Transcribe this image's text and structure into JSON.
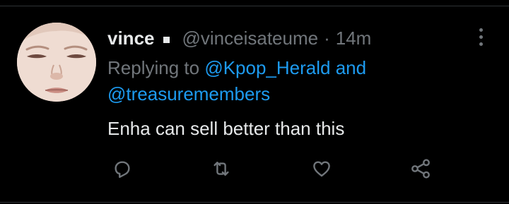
{
  "tweet": {
    "display_name": "vince",
    "handle": "@vinceisateume",
    "separator": "·",
    "timestamp": "14m",
    "reply_prefix": "Replying to ",
    "reply_mention_1": "@Kpop_Herald",
    "reply_conjunction": " and",
    "reply_mention_2": "@treasuremembers",
    "text": "Enha can sell better than this"
  },
  "icons": {
    "more": "more-vertical-icon",
    "reply": "reply-icon",
    "retweet": "retweet-icon",
    "like": "heart-icon",
    "share": "share-icon"
  },
  "colors": {
    "background": "#000000",
    "text_primary": "#e7e9ea",
    "text_secondary": "#71767b",
    "link": "#1d9bf0"
  }
}
